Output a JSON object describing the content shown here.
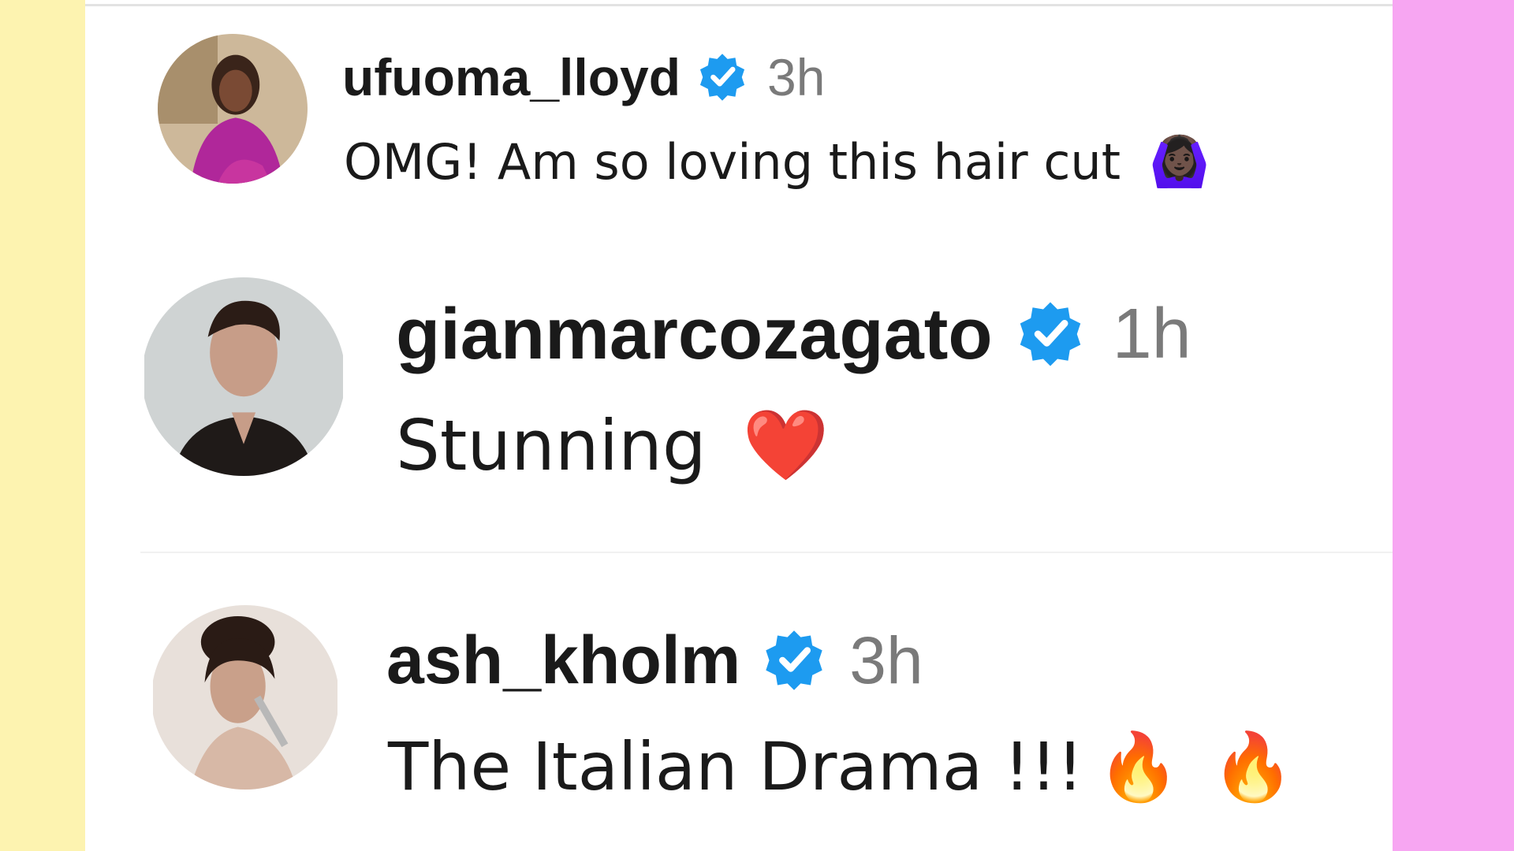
{
  "colors": {
    "left_band": "#fdf3b0",
    "right_band": "#f7a6f2",
    "verified_badge": "#1d9bf0",
    "username": "#1a1a1a",
    "timestamp": "#7a7a7a"
  },
  "comments": [
    {
      "username": "ufuoma_lloyd",
      "verified": true,
      "time": "3h",
      "text": "OMG! Am so loving this hair cut",
      "emoji": [
        "🙆🏿‍♀️"
      ],
      "avatar_icon": "profile-avatar"
    },
    {
      "username": "gianmarcozagato",
      "verified": true,
      "time": "1h",
      "text": "Stunning",
      "emoji": [
        "❤️"
      ],
      "avatar_icon": "profile-avatar"
    },
    {
      "username": "ash_kholm",
      "verified": true,
      "time": "3h",
      "text": "The Italian Drama !!!",
      "emoji": [
        "🔥",
        "🔥"
      ],
      "avatar_icon": "profile-avatar"
    }
  ]
}
